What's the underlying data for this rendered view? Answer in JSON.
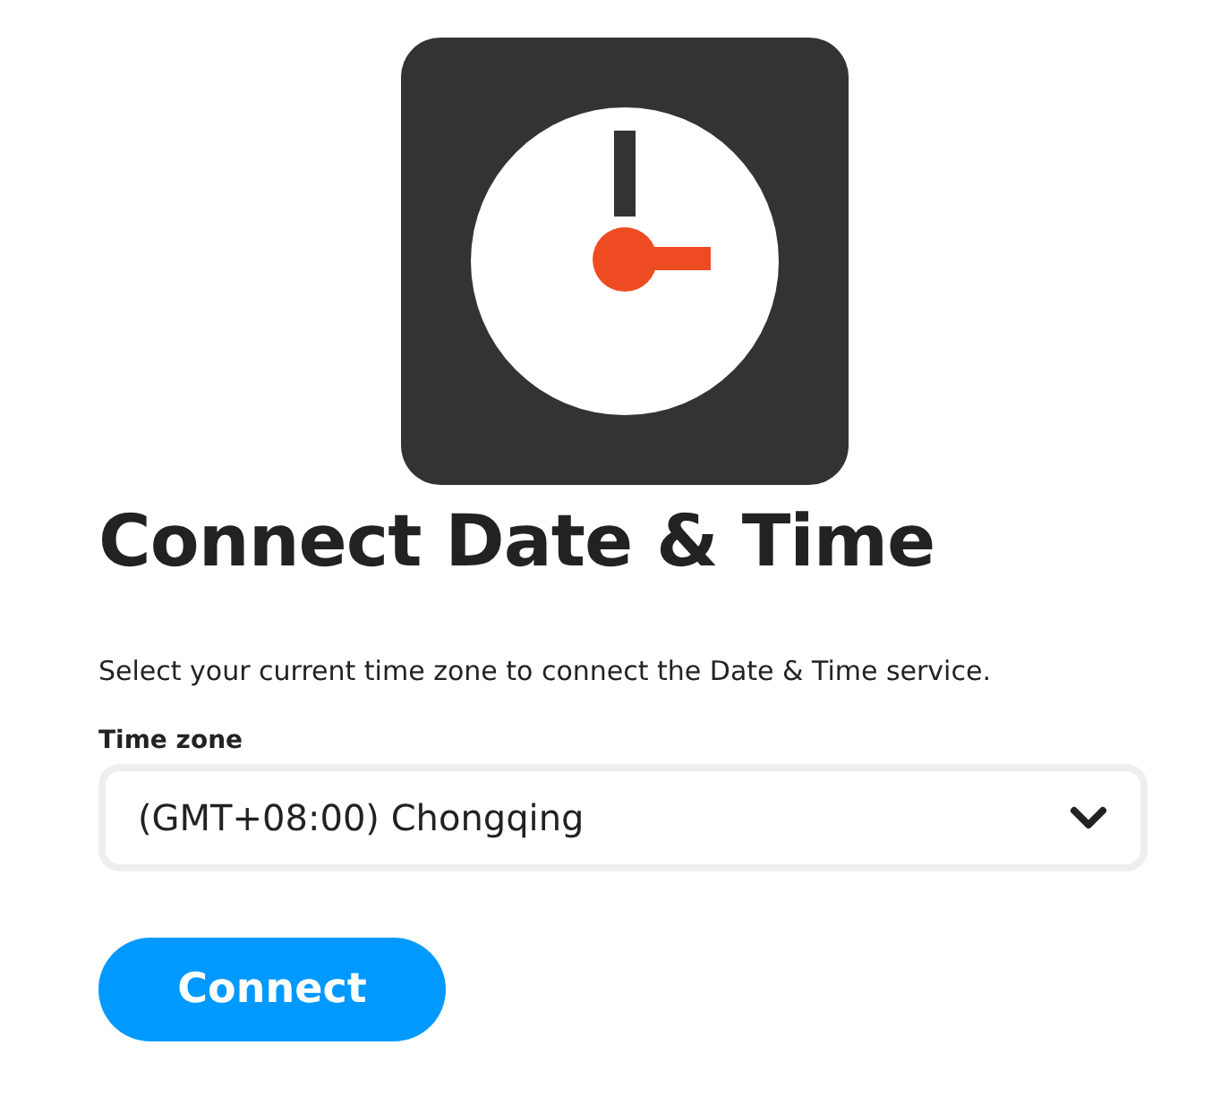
{
  "title": "Connect Date & Time",
  "description": "Select your current time zone to connect the Date & Time service.",
  "time_zone": {
    "label": "Time zone",
    "value": "(GMT+08:00) Chongqing"
  },
  "buttons": [
    "Connect"
  ]
}
